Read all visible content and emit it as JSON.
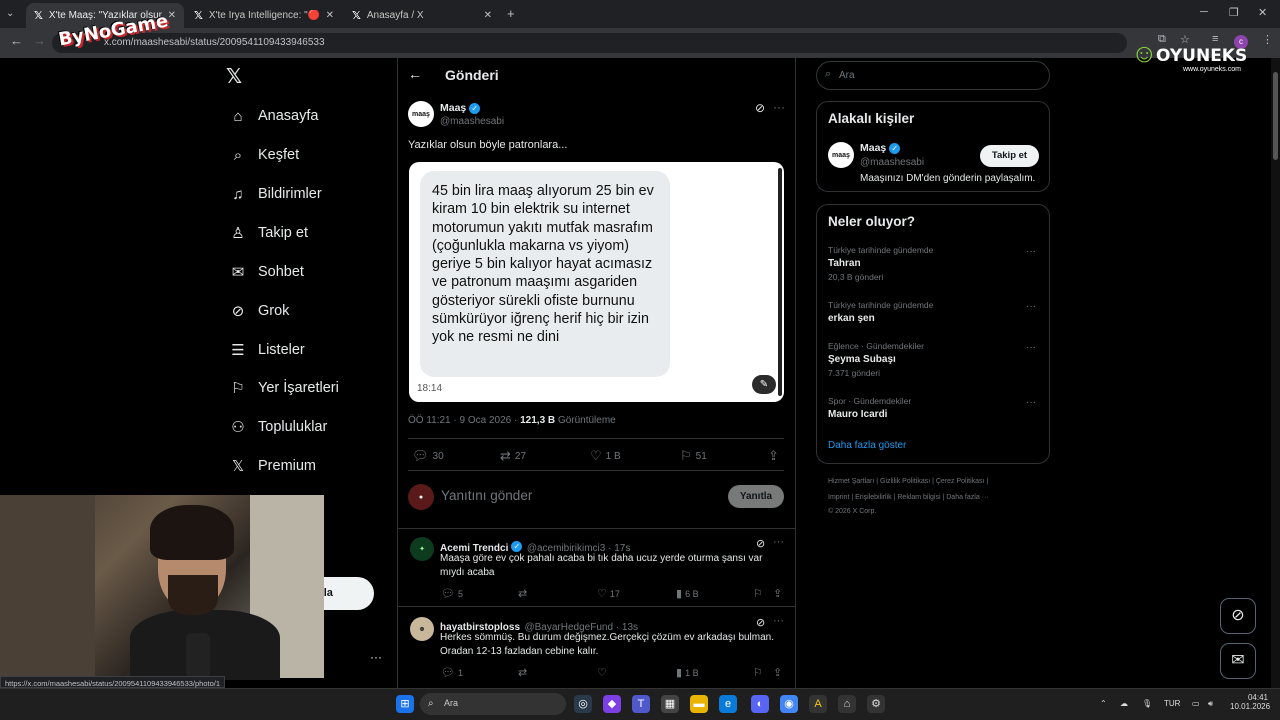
{
  "browser": {
    "tabs": [
      {
        "title": "X'te Maaş: \"Yazıklar olsun böyle",
        "active": true
      },
      {
        "title": "X'te Irya Intelligence: \"🔴 Sosy",
        "active": false
      },
      {
        "title": "Anasayfa / X",
        "active": false
      }
    ],
    "url": "x.com/maashesabi/status/2009541109433946533",
    "status_url": "https://x.com/maashesabi/status/2009541109433946533/photo/1"
  },
  "overlay": {
    "left_logo": "ByNoGame",
    "right_logo": "OYUNEKS",
    "right_logo_sub": "www.oyuneks.com"
  },
  "nav": {
    "items": [
      {
        "label": "Anasayfa",
        "icon": "home-icon"
      },
      {
        "label": "Keşfet",
        "icon": "search-icon"
      },
      {
        "label": "Bildirimler",
        "icon": "bell-icon"
      },
      {
        "label": "Takip et",
        "icon": "follow-icon"
      },
      {
        "label": "Sohbet",
        "icon": "mail-icon"
      },
      {
        "label": "Grok",
        "icon": "grok-icon"
      },
      {
        "label": "Listeler",
        "icon": "list-icon"
      },
      {
        "label": "Yer İşaretleri",
        "icon": "bookmark-icon"
      },
      {
        "label": "Topluluklar",
        "icon": "communities-icon"
      },
      {
        "label": "Premium",
        "icon": "x-icon"
      }
    ],
    "post_button_partial": "nla"
  },
  "post": {
    "header": "Gönderi",
    "author_name": "Maaş",
    "author_handle": "@maashesabi",
    "avatar_text": "maaş",
    "text": "Yazıklar olsun böyle patronlara...",
    "image_text": "45 bin lira maaş alıyorum 25 bin ev kiram 10 bin elektrik su internet motorumun yakıtı mutfak masrafım (çoğunlukla makarna vs yiyom) geriye 5 bin kalıyor hayat acımasız ve patronum maaşımı asgariden gösteriyor sürekli ofiste burnunu sümkürüyor iğrenç herif hiç bir izin yok ne resmi ne dini",
    "image_time": "18:14",
    "timestamp": "ÖÖ 11:21 · 9 Oca 2026 · ",
    "views": "121,3 B",
    "views_label": " Görüntüleme",
    "replies": "30",
    "reposts": "27",
    "likes": "1 B",
    "bookmarks": "51",
    "reply_placeholder": "Yanıtını gönder",
    "reply_button": "Yanıtla"
  },
  "comments": [
    {
      "name": "Acemi Trendci",
      "handle": "@acemibirikimci3 · 17s",
      "text": "Maaşa göre ev çok pahalı acaba bi tık daha ucuz yerde oturma şansı var mıydı acaba",
      "replies": "5",
      "reposts": "",
      "likes": "17",
      "views": "6 B"
    },
    {
      "name": "hayatbirstoploss",
      "handle": "@BayarHedgeFund · 13s",
      "text": "Herkes sömmüş. Bu durum değişmez.Gerçekçi çözüm ev arkadaşı bulman. Oradan 12-13 fazladan cebine kalır.",
      "replies": "1",
      "reposts": "",
      "likes": "",
      "views": "1 B"
    }
  ],
  "sidebar": {
    "search_placeholder": "Ara",
    "related_title": "Alakalı kişiler",
    "related_name": "Maaş",
    "related_handle": "@maashesabi",
    "related_bio": "Maaşınızı DM'den gönderin paylaşalım.",
    "follow_button": "Takip et",
    "trends_title": "Neler oluyor?",
    "trends": [
      {
        "category": "Türkiye tarihinde gündemde",
        "name": "Tahran",
        "count": "20,3 B gönderi"
      },
      {
        "category": "Türkiye tarihinde gündemde",
        "name": "erkan şen",
        "count": ""
      },
      {
        "category": "Eğlence · Gündemdekiler",
        "name": "Şeyma Subaşı",
        "count": "7.371 gönderi"
      },
      {
        "category": "Spor · Gündemdekiler",
        "name": "Mauro Icardi",
        "count": ""
      }
    ],
    "show_more": "Daha fazla göster",
    "footer_line1": "Hizmet Şartları  |  Gizlilik Politikası  |  Çerez Politikası  |",
    "footer_line2": "Imprint  |  Erişilebilirlik  |  Reklam bilgisi  |  Daha fazla ···",
    "footer_line3": "© 2026 X Corp."
  },
  "taskbar": {
    "search": "Ara",
    "lang": "TUR",
    "time": "04:41",
    "date": "10.01.2026"
  }
}
